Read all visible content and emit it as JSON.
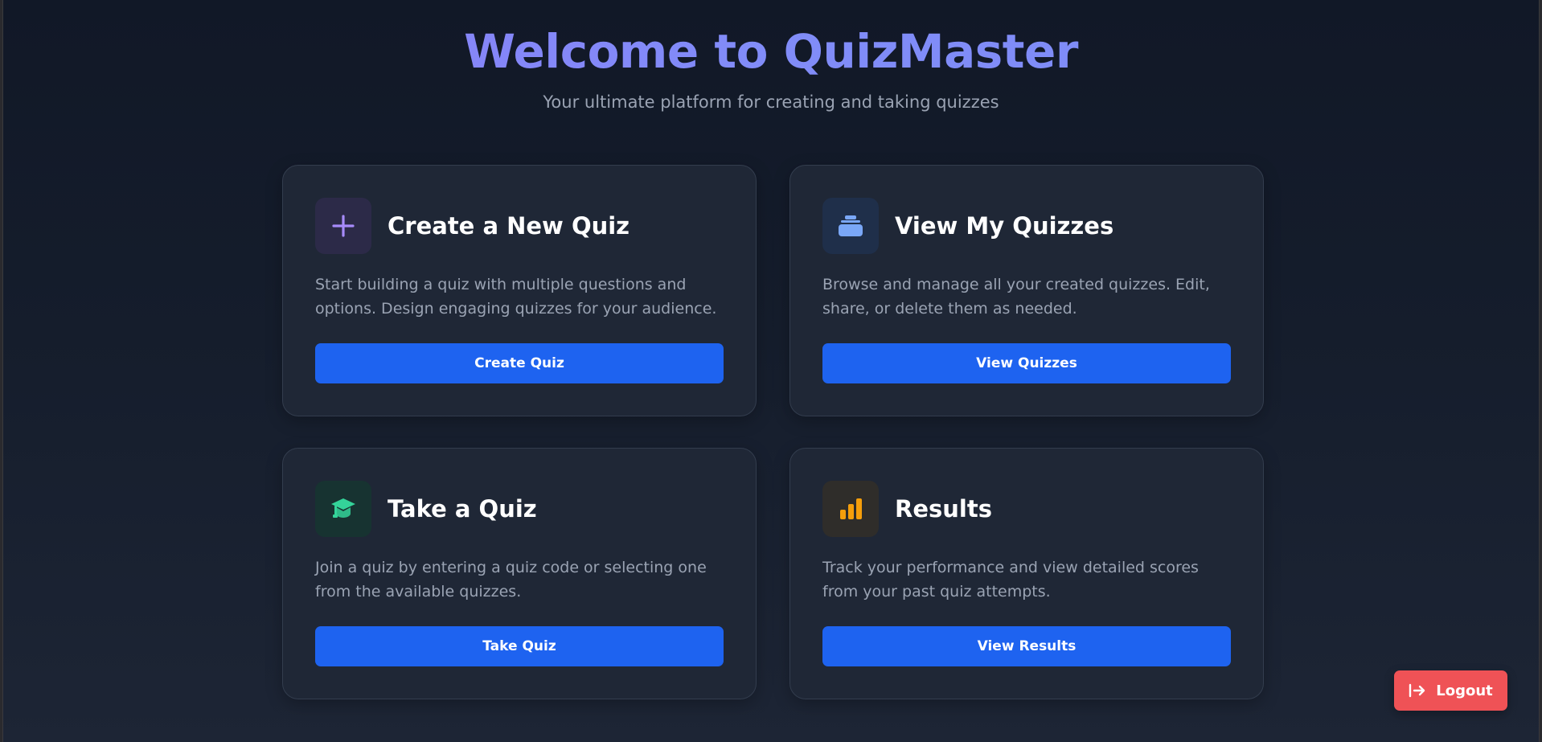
{
  "hero": {
    "title": "Welcome to QuizMaster",
    "subtitle": "Your ultimate platform for creating and taking quizzes"
  },
  "cards": [
    {
      "icon": "plus-icon",
      "icon_color": "#a78bfa",
      "title": "Create a New Quiz",
      "description": "Start building a quiz with multiple questions and options. Design engaging quizzes for your audience.",
      "button_label": "Create Quiz"
    },
    {
      "icon": "stack-icon",
      "icon_color": "#7aa7f7",
      "title": "View My Quizzes",
      "description": "Browse and manage all your created quizzes. Edit, share, or delete them as needed.",
      "button_label": "View Quizzes"
    },
    {
      "icon": "graduation-cap-icon",
      "icon_color": "#34d399",
      "title": "Take a Quiz",
      "description": "Join a quiz by entering a quiz code or selecting one from the available quizzes.",
      "button_label": "Take Quiz"
    },
    {
      "icon": "bar-chart-icon",
      "icon_color": "#f59e0b",
      "title": "Results",
      "description": "Track your performance and view detailed scores from your past quiz attempts.",
      "button_label": "View Results"
    }
  ],
  "logout": {
    "icon": "logout-icon",
    "label": "Logout"
  },
  "colors": {
    "accent": "#1e63f0",
    "danger": "#ef5256",
    "title_gradient": "#818cf8"
  }
}
